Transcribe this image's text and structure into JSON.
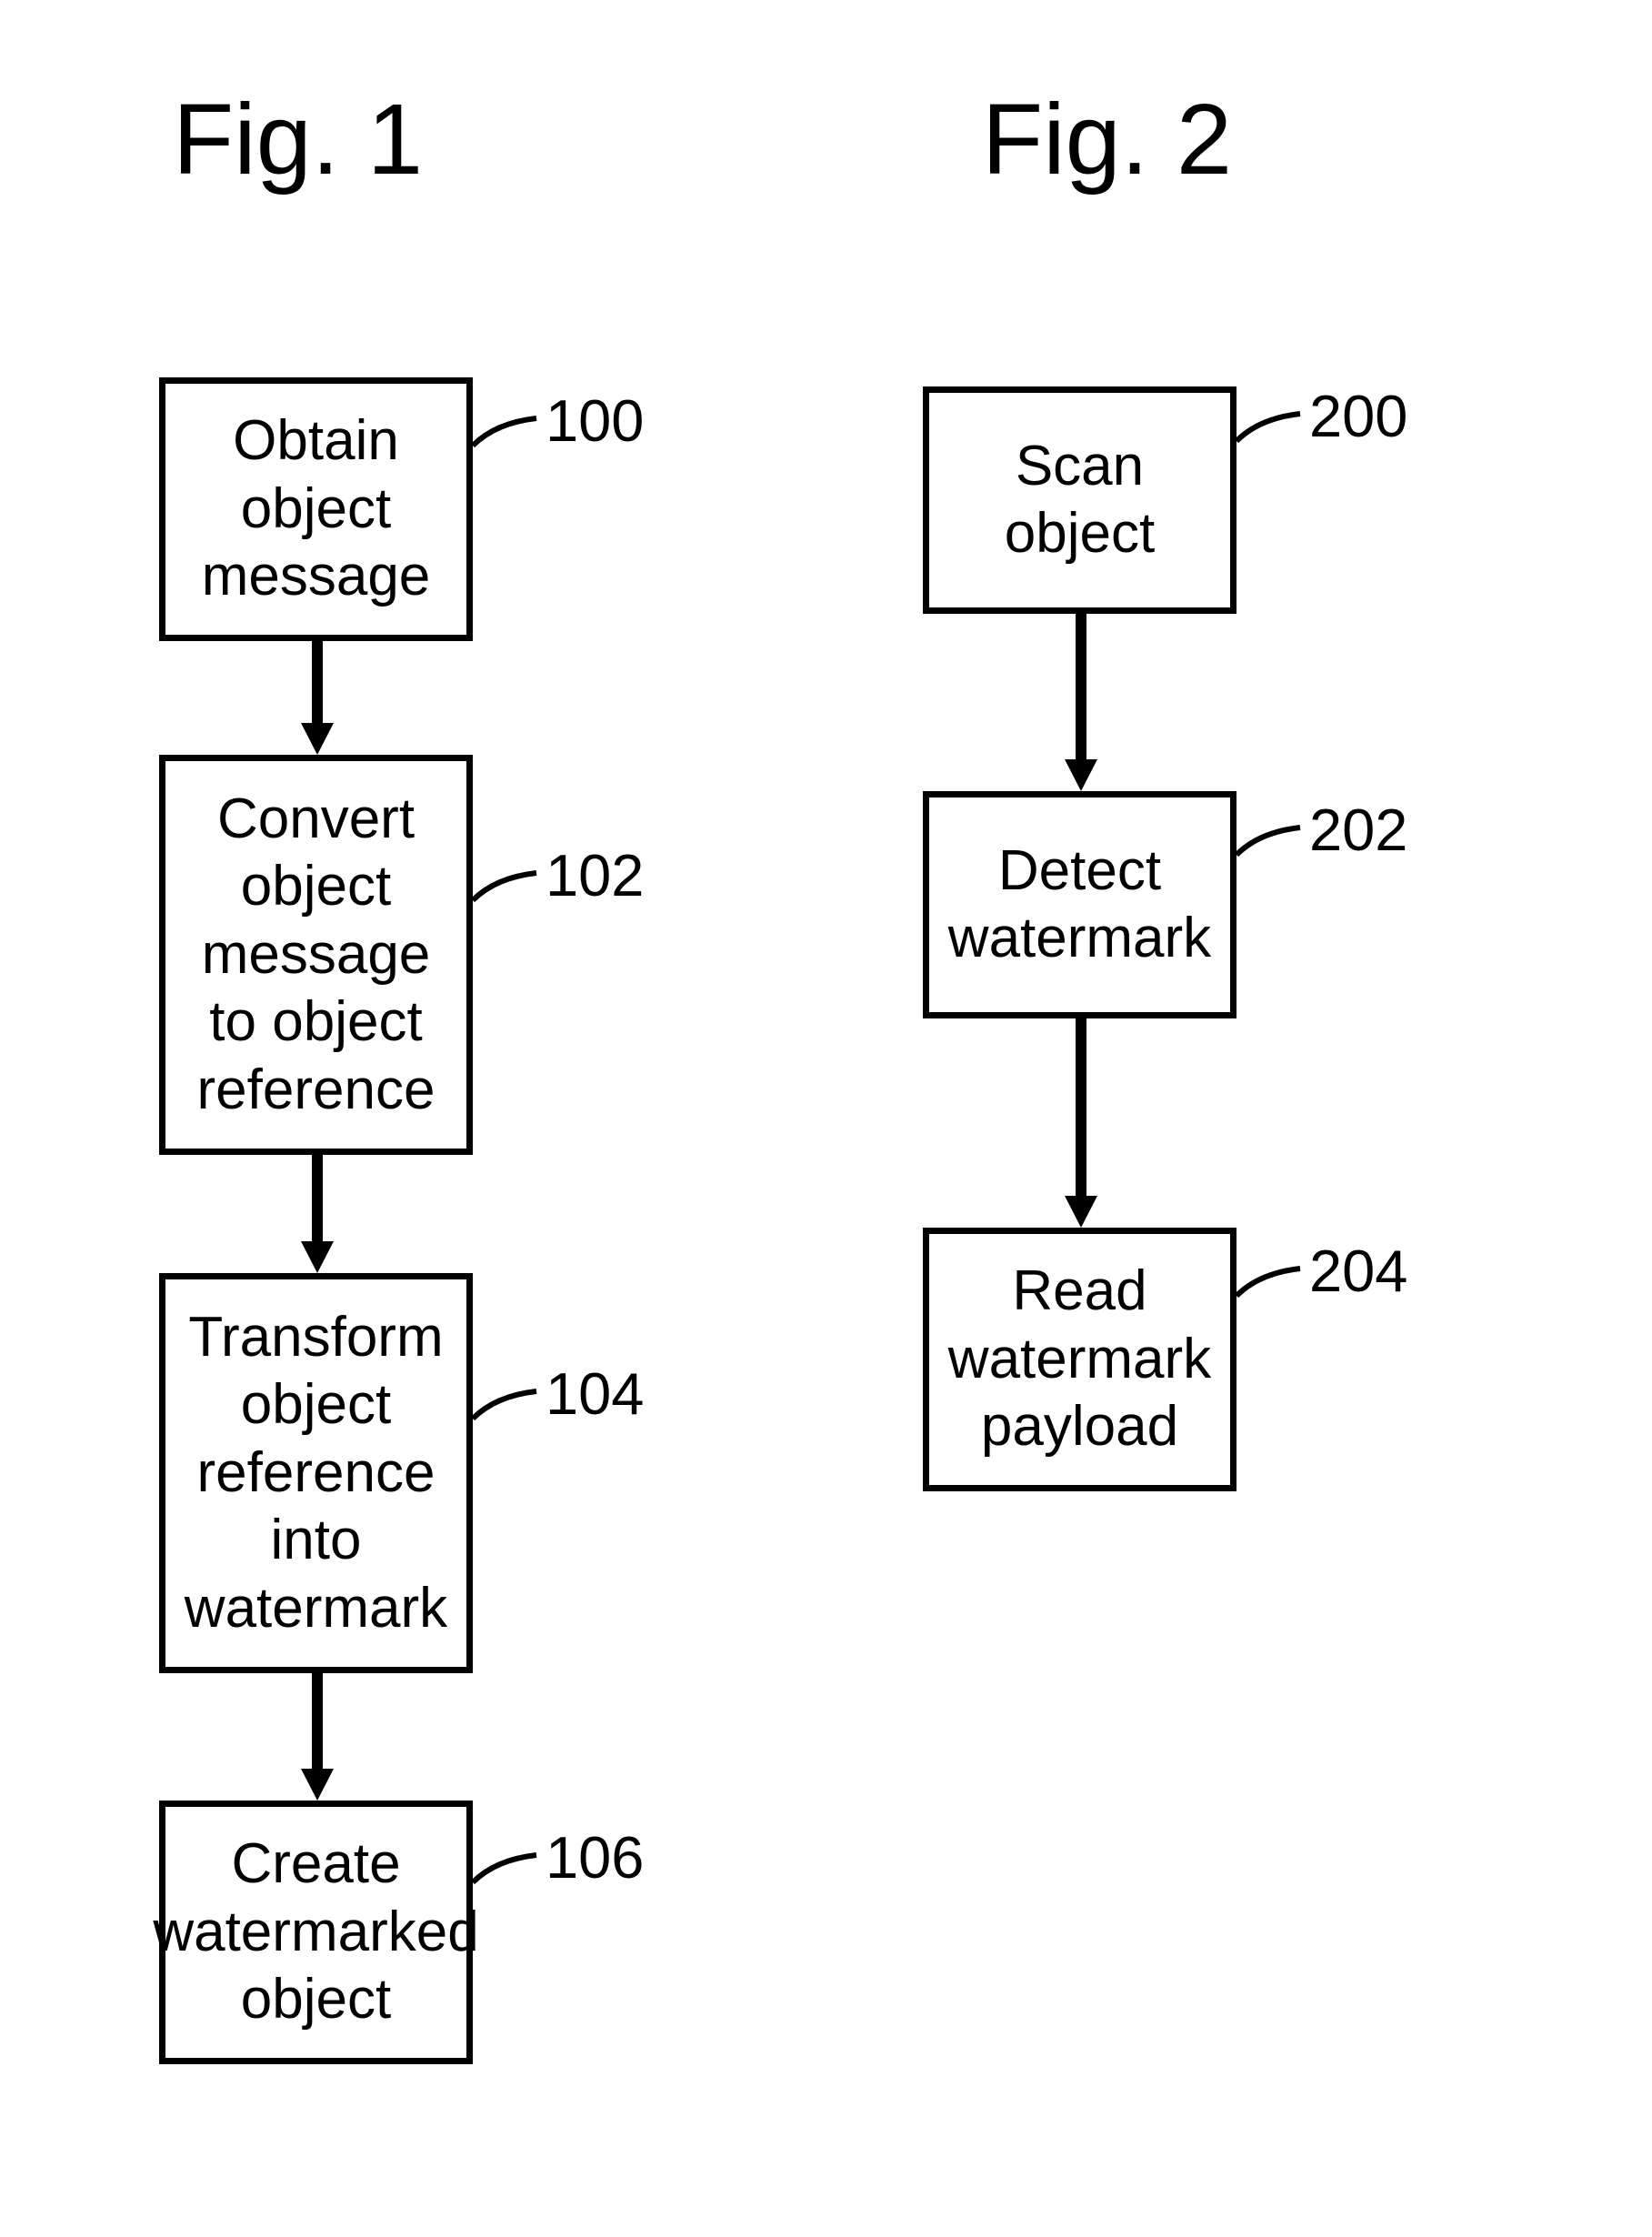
{
  "fig1": {
    "title": "Fig. 1",
    "steps": [
      {
        "text": "Obtain object message",
        "label": "100"
      },
      {
        "text": "Convert object message to object reference",
        "label": "102"
      },
      {
        "text": "Transform object reference into watermark",
        "label": "104"
      },
      {
        "text": "Create watermarked object",
        "label": "106"
      }
    ]
  },
  "fig2": {
    "title": "Fig. 2",
    "steps": [
      {
        "text": "Scan object",
        "label": "200"
      },
      {
        "text": "Detect watermark",
        "label": "202"
      },
      {
        "text": "Read watermark payload",
        "label": "204"
      }
    ]
  }
}
